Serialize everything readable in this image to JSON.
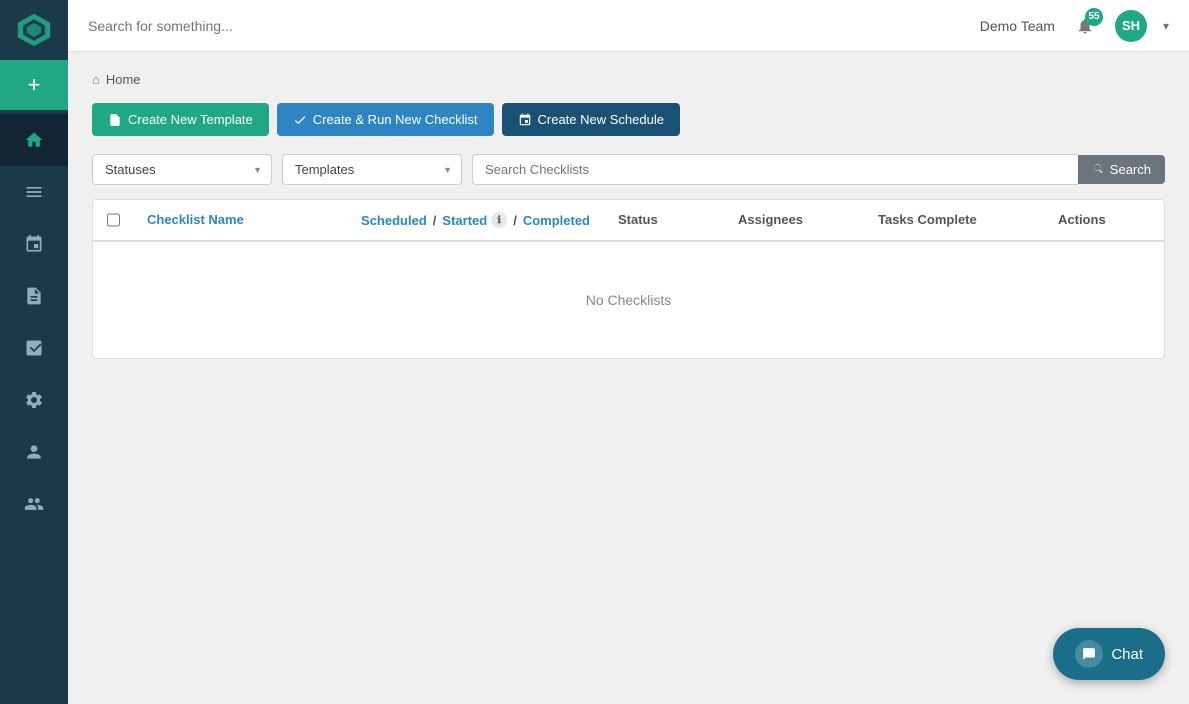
{
  "app": {
    "logo_alt": "App logo"
  },
  "sidebar": {
    "add_label": "+",
    "items": [
      {
        "id": "home",
        "icon": "🏠",
        "label": "Home",
        "active": true
      },
      {
        "id": "list",
        "icon": "☰",
        "label": "Lists",
        "active": false
      },
      {
        "id": "calendar",
        "icon": "📅",
        "label": "Calendar",
        "active": false
      },
      {
        "id": "doc",
        "icon": "📄",
        "label": "Documents",
        "active": false
      },
      {
        "id": "chart",
        "icon": "📊",
        "label": "Reports",
        "active": false
      },
      {
        "id": "wrench",
        "icon": "🔧",
        "label": "Settings",
        "active": false
      },
      {
        "id": "user",
        "icon": "👤",
        "label": "User",
        "active": false
      },
      {
        "id": "team",
        "icon": "👥",
        "label": "Team",
        "active": false
      }
    ]
  },
  "topbar": {
    "search_placeholder": "Search for something...",
    "team_name": "Demo Team",
    "notif_count": "55",
    "avatar_initials": "SH"
  },
  "breadcrumb": {
    "home_label": "Home"
  },
  "buttons": {
    "create_template": "Create New Template",
    "create_run": "Create & Run New Checklist",
    "create_schedule": "Create New Schedule"
  },
  "filters": {
    "status_label": "Statuses",
    "template_label": "Templates",
    "search_placeholder": "Search Checklists",
    "search_btn": "Search"
  },
  "table": {
    "col_checkbox": "",
    "col_name": "Checklist Name",
    "col_scheduled": "Scheduled",
    "col_started": "Started",
    "col_completed": "Completed",
    "col_status": "Status",
    "col_assignees": "Assignees",
    "col_tasks": "Tasks Complete",
    "col_actions": "Actions",
    "empty_message": "No Checklists"
  },
  "chat": {
    "label": "Chat"
  }
}
